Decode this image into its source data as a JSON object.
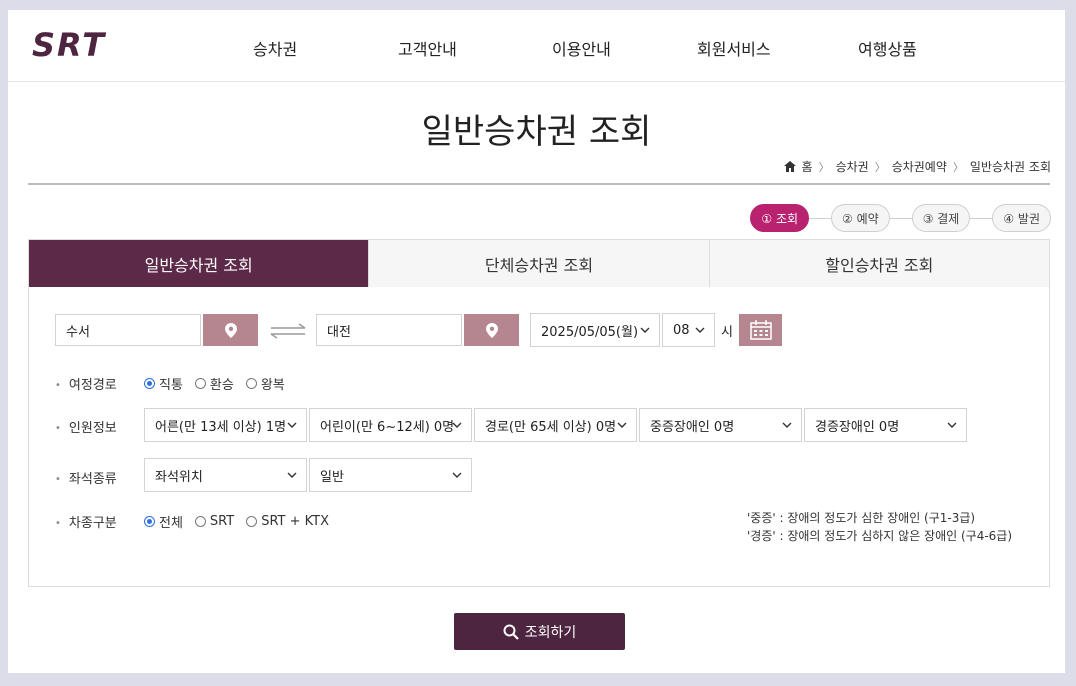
{
  "logo": {
    "text": "SRT"
  },
  "nav": {
    "items": [
      "승차권",
      "고객안내",
      "이용안내",
      "회원서비스",
      "여행상품"
    ]
  },
  "page_title": "일반승차권 조회",
  "breadcrumb": {
    "home_icon": "home-icon",
    "items": [
      "홈",
      "승차권",
      "승차권예약",
      "일반승차권 조회"
    ]
  },
  "steps": [
    {
      "label": "① 조회",
      "active": true
    },
    {
      "label": "② 예약",
      "active": false
    },
    {
      "label": "③ 결제",
      "active": false
    },
    {
      "label": "④ 발권",
      "active": false
    }
  ],
  "tabs": [
    {
      "label": "일반승차권 조회",
      "active": true
    },
    {
      "label": "단체승차권 조회",
      "active": false
    },
    {
      "label": "할인승차권 조회",
      "active": false
    }
  ],
  "search": {
    "departure": "수서",
    "arrival": "대전",
    "date": "2025/05/05(월)",
    "hour": "08",
    "hour_unit": "시"
  },
  "trip_route": {
    "label": "여정경로",
    "options": [
      "직통",
      "환승",
      "왕복"
    ],
    "selected": "직통"
  },
  "passengers": {
    "label": "인원정보",
    "selects": [
      "어른(만 13세 이상) 1명",
      "어린이(만 6~12세) 0명",
      "경로(만 65세 이상) 0명",
      "중증장애인 0명",
      "경증장애인 0명"
    ]
  },
  "seat_type": {
    "label": "좌석종류",
    "selects": [
      "좌석위치",
      "일반"
    ]
  },
  "train_type": {
    "label": "차종구분",
    "options": [
      "전체",
      "SRT",
      "SRT + KTX"
    ],
    "selected": "전체"
  },
  "notes": [
    "'중증' : 장애의 정도가 심한 장애인 (구1-3급)",
    "'경증' : 장애의 정도가 심하지 않은 장애인 (구4-6급)"
  ],
  "submit": {
    "label": "조회하기"
  },
  "colors": {
    "brand": "#5c2a48",
    "accent": "#b8226e",
    "pin": "#b5868f",
    "background": "#dcdde8"
  }
}
